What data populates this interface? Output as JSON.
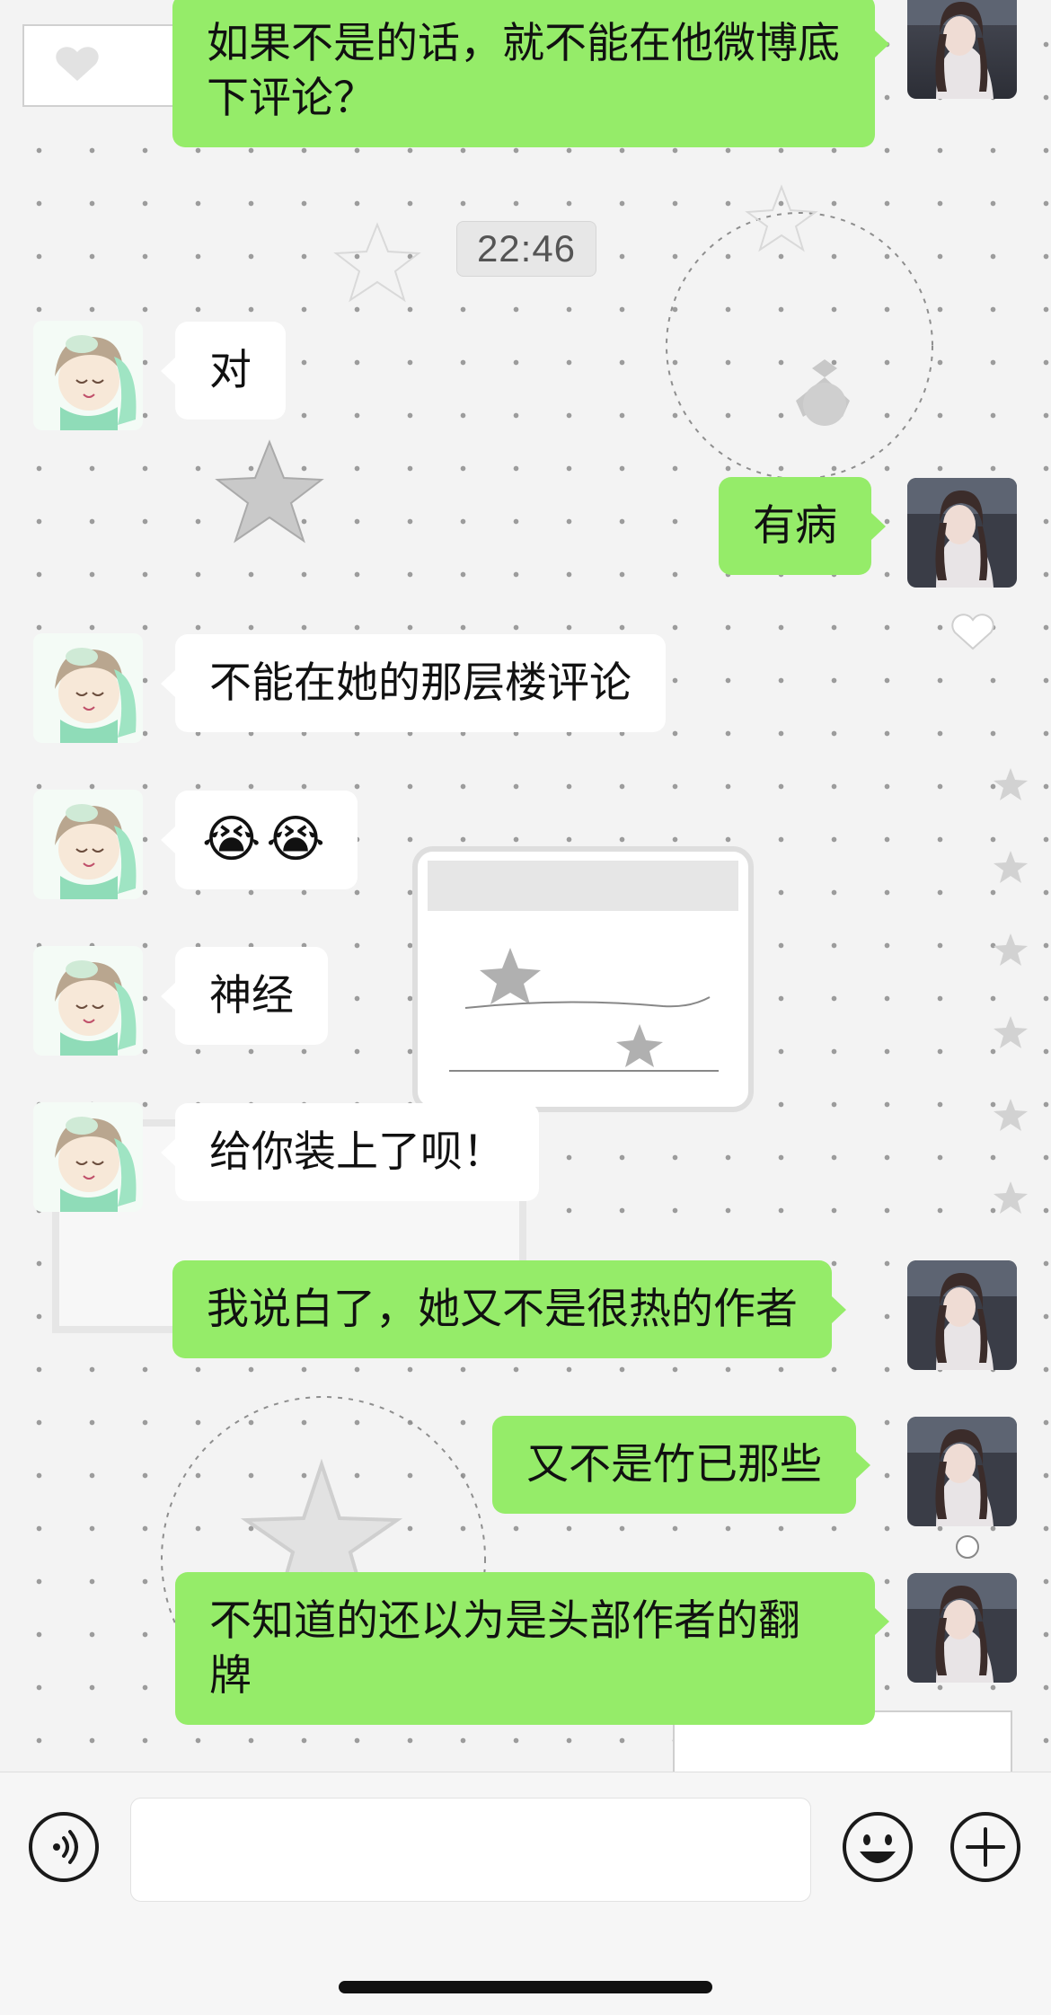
{
  "chat": {
    "timestamp": "22:46",
    "messages": [
      {
        "side": "out",
        "text": "如果不是的话，就不能在他微博底下评论？"
      },
      {
        "side": "in",
        "text": "对"
      },
      {
        "side": "out",
        "text": "有病"
      },
      {
        "side": "in",
        "text": "不能在她的那层楼评论"
      },
      {
        "side": "in",
        "text": "😭😭"
      },
      {
        "side": "in",
        "text": "神经"
      },
      {
        "side": "in",
        "text": "给你装上了呗！"
      },
      {
        "side": "out",
        "text": "我说白了，她又不是很热的作者"
      },
      {
        "side": "out",
        "text": "又不是竹已那些"
      },
      {
        "side": "out",
        "text": "不知道的还以为是头部作者的翻牌"
      }
    ]
  },
  "input_bar": {
    "message_input_value": "",
    "icons": [
      "voice-icon",
      "emoji-icon",
      "add-icon"
    ]
  },
  "colors": {
    "outgoing_bubble": "#95ec69",
    "incoming_bubble": "#ffffff"
  }
}
